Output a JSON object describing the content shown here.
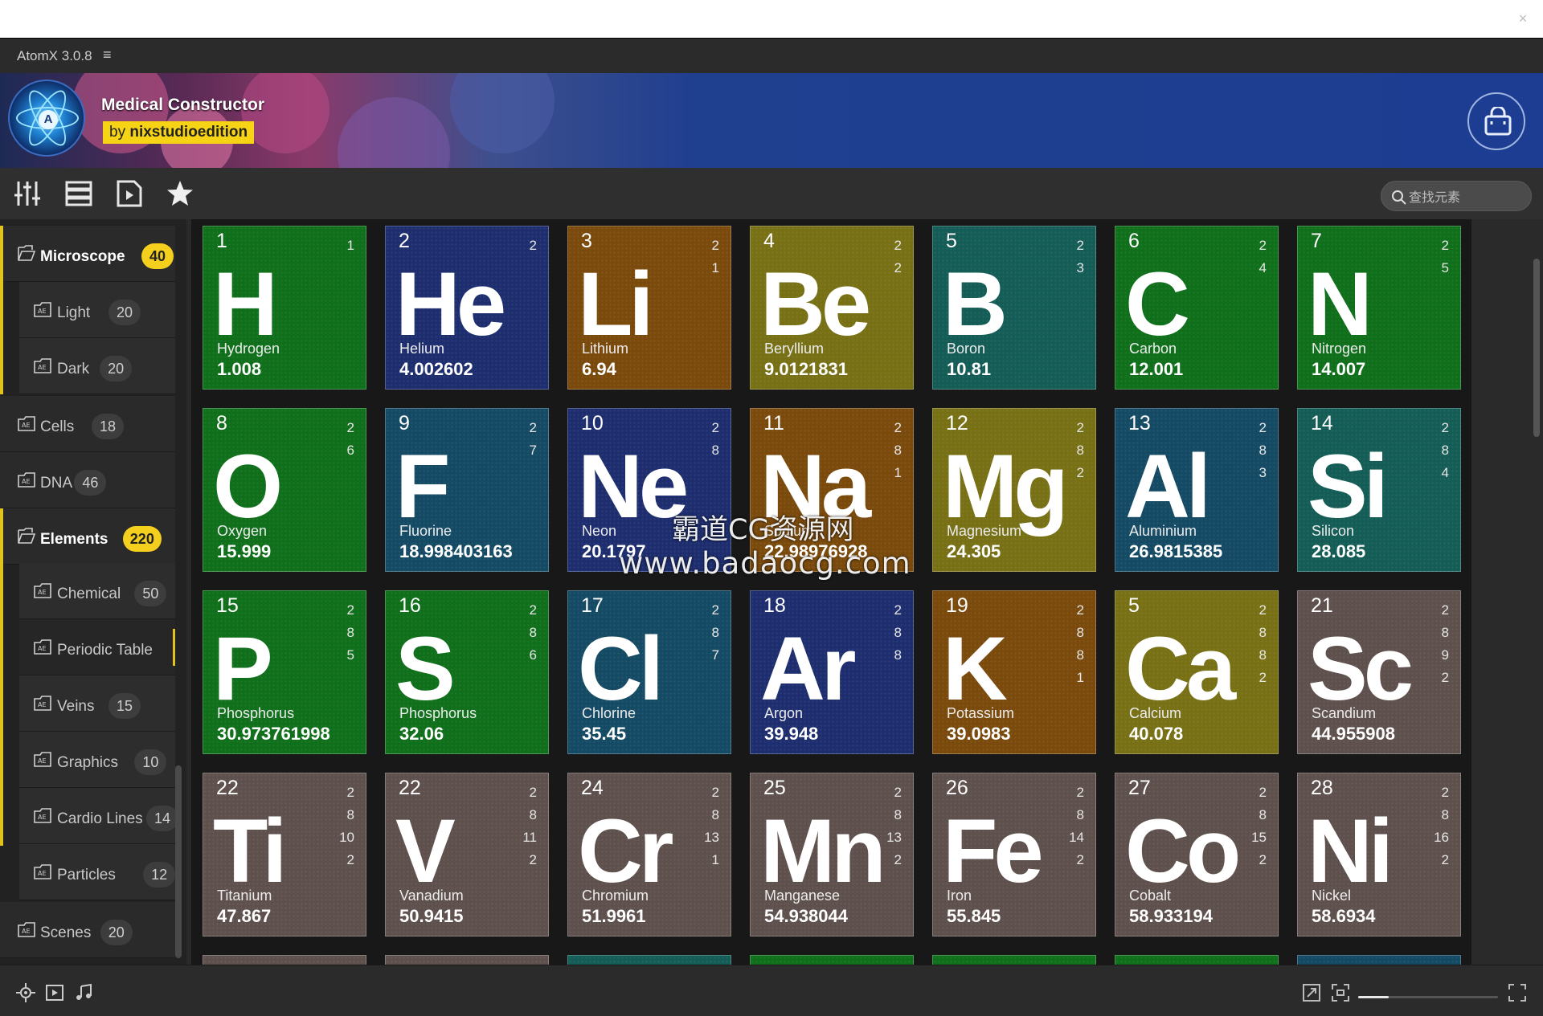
{
  "window": {
    "title": "AtomX 3.0.8",
    "menu_glyph": "≡",
    "close_glyph": "×"
  },
  "banner": {
    "product": "Medical Constructor",
    "author_prefix": "by",
    "author": "nixstudioedition",
    "logo_letter": "A"
  },
  "search": {
    "placeholder": "查找元素"
  },
  "sidebar": [
    {
      "label": "Microscope",
      "count": "40",
      "level": 0,
      "bold": true,
      "highlight": true
    },
    {
      "label": "Light",
      "count": "20",
      "level": 1
    },
    {
      "label": "Dark",
      "count": "20",
      "level": 1
    },
    {
      "label": "Cells",
      "count": "18",
      "level": 0
    },
    {
      "label": "DNA",
      "count": "46",
      "level": 0
    },
    {
      "label": "Elements",
      "count": "220",
      "level": 0,
      "bold": true,
      "highlight": true
    },
    {
      "label": "Chemical",
      "count": "50",
      "level": 1
    },
    {
      "label": "Periodic Table",
      "count": "",
      "level": 1,
      "active": true
    },
    {
      "label": "Veins",
      "count": "15",
      "level": 1
    },
    {
      "label": "Graphics",
      "count": "10",
      "level": 1
    },
    {
      "label": "Cardio Lines",
      "count": "14",
      "level": 1
    },
    {
      "label": "Particles",
      "count": "12",
      "level": 1
    },
    {
      "label": "Scenes",
      "count": "20",
      "level": 0
    }
  ],
  "colors": {
    "green": "#0f6f1a",
    "navy": "#1d2d6e",
    "orange": "#7a4a0c",
    "olive": "#777015",
    "teal": "#145c56",
    "blue": "#144a64",
    "gray": "#5e504c",
    "accent": "#f4cf1d"
  },
  "elements": [
    {
      "n": "1",
      "sym": "H",
      "name": "Hydrogen",
      "mass": "1.008",
      "shells": [
        "1"
      ],
      "c": "green"
    },
    {
      "n": "2",
      "sym": "He",
      "name": "Helium",
      "mass": "4.002602",
      "shells": [
        "2"
      ],
      "c": "navy"
    },
    {
      "n": "3",
      "sym": "Li",
      "name": "Lithium",
      "mass": "6.94",
      "shells": [
        "2",
        "1"
      ],
      "c": "orange"
    },
    {
      "n": "4",
      "sym": "Be",
      "name": "Beryllium",
      "mass": "9.0121831",
      "shells": [
        "2",
        "2"
      ],
      "c": "olive"
    },
    {
      "n": "5",
      "sym": "B",
      "name": "Boron",
      "mass": "10.81",
      "shells": [
        "2",
        "3"
      ],
      "c": "teal"
    },
    {
      "n": "6",
      "sym": "C",
      "name": "Carbon",
      "mass": "12.001",
      "shells": [
        "2",
        "4"
      ],
      "c": "green"
    },
    {
      "n": "7",
      "sym": "N",
      "name": "Nitrogen",
      "mass": "14.007",
      "shells": [
        "2",
        "5"
      ],
      "c": "green"
    },
    {
      "n": "8",
      "sym": "O",
      "name": "Oxygen",
      "mass": "15.999",
      "shells": [
        "2",
        "6"
      ],
      "c": "green"
    },
    {
      "n": "9",
      "sym": "F",
      "name": "Fluorine",
      "mass": "18.998403163",
      "shells": [
        "2",
        "7"
      ],
      "c": "blue"
    },
    {
      "n": "10",
      "sym": "Ne",
      "name": "Neon",
      "mass": "20.1797",
      "shells": [
        "2",
        "8"
      ],
      "c": "navy"
    },
    {
      "n": "11",
      "sym": "Na",
      "name": "Sodium",
      "mass": "22.98976928",
      "shells": [
        "2",
        "8",
        "1"
      ],
      "c": "orange"
    },
    {
      "n": "12",
      "sym": "Mg",
      "name": "Magnesium",
      "mass": "24.305",
      "shells": [
        "2",
        "8",
        "2"
      ],
      "c": "olive"
    },
    {
      "n": "13",
      "sym": "Al",
      "name": "Aluminium",
      "mass": "26.9815385",
      "shells": [
        "2",
        "8",
        "3"
      ],
      "c": "blue"
    },
    {
      "n": "14",
      "sym": "Si",
      "name": "Silicon",
      "mass": "28.085",
      "shells": [
        "2",
        "8",
        "4"
      ],
      "c": "teal"
    },
    {
      "n": "15",
      "sym": "P",
      "name": "Phosphorus",
      "mass": "30.973761998",
      "shells": [
        "2",
        "8",
        "5"
      ],
      "c": "green"
    },
    {
      "n": "16",
      "sym": "S",
      "name": "Phosphorus",
      "mass": "32.06",
      "shells": [
        "2",
        "8",
        "6"
      ],
      "c": "green"
    },
    {
      "n": "17",
      "sym": "Cl",
      "name": "Chlorine",
      "mass": "35.45",
      "shells": [
        "2",
        "8",
        "7"
      ],
      "c": "blue"
    },
    {
      "n": "18",
      "sym": "Ar",
      "name": "Argon",
      "mass": "39.948",
      "shells": [
        "2",
        "8",
        "8"
      ],
      "c": "navy"
    },
    {
      "n": "19",
      "sym": "K",
      "name": "Potassium",
      "mass": "39.0983",
      "shells": [
        "2",
        "8",
        "8",
        "1"
      ],
      "c": "orange"
    },
    {
      "n": "5",
      "sym": "Ca",
      "name": "Calcium",
      "mass": "40.078",
      "shells": [
        "2",
        "8",
        "8",
        "2"
      ],
      "c": "olive"
    },
    {
      "n": "21",
      "sym": "Sc",
      "name": "Scandium",
      "mass": "44.955908",
      "shells": [
        "2",
        "8",
        "9",
        "2"
      ],
      "c": "gray"
    },
    {
      "n": "22",
      "sym": "Ti",
      "name": "Titanium",
      "mass": "47.867",
      "shells": [
        "2",
        "8",
        "10",
        "2"
      ],
      "c": "gray"
    },
    {
      "n": "22",
      "sym": "V",
      "name": "Vanadium",
      "mass": "50.9415",
      "shells": [
        "2",
        "8",
        "11",
        "2"
      ],
      "c": "gray"
    },
    {
      "n": "24",
      "sym": "Cr",
      "name": "Chromium",
      "mass": "51.9961",
      "shells": [
        "2",
        "8",
        "13",
        "1"
      ],
      "c": "gray"
    },
    {
      "n": "25",
      "sym": "Mn",
      "name": "Manganese",
      "mass": "54.938044",
      "shells": [
        "2",
        "8",
        "13",
        "2"
      ],
      "c": "gray"
    },
    {
      "n": "26",
      "sym": "Fe",
      "name": "Iron",
      "mass": "55.845",
      "shells": [
        "2",
        "8",
        "14",
        "2"
      ],
      "c": "gray"
    },
    {
      "n": "27",
      "sym": "Co",
      "name": "Cobalt",
      "mass": "58.933194",
      "shells": [
        "2",
        "8",
        "15",
        "2"
      ],
      "c": "gray"
    },
    {
      "n": "28",
      "sym": "Ni",
      "name": "Nickel",
      "mass": "58.6934",
      "shells": [
        "2",
        "8",
        "16",
        "2"
      ],
      "c": "gray"
    }
  ],
  "partial_row_colors": [
    "gray",
    "gray",
    "teal",
    "green",
    "green",
    "green",
    "blue"
  ],
  "watermark": {
    "line1": "霸道CG资源网",
    "line2": "www.badaocg.com"
  },
  "zoom": {
    "level": 0.22
  }
}
